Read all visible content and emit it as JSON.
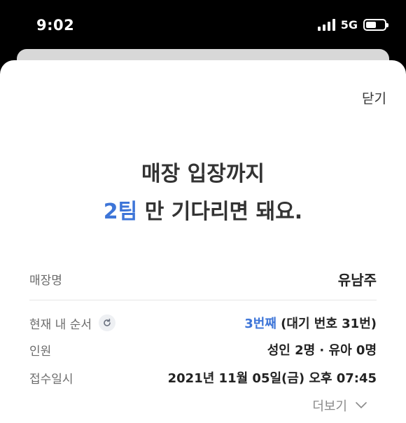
{
  "status_bar": {
    "time": "9:02",
    "network": "5G"
  },
  "sheet": {
    "close_label": "닫기",
    "headline": {
      "line1": "매장 입장까지",
      "teams": "2팀",
      "line2_rest": " 만 기다리면 돼요."
    },
    "rows": {
      "store": {
        "label": "매장명",
        "value": "유남주"
      },
      "order": {
        "label": "현재 내 순서",
        "value_accent": "3번째",
        "value_rest": " (대기 번호 31번)"
      },
      "party": {
        "label": "인원",
        "value": "성인 2명 · 유아 0명"
      },
      "received": {
        "label": "접수일시",
        "value": "2021년 11월 05일(금) 오후 07:45"
      }
    },
    "more_label": "더보기"
  }
}
